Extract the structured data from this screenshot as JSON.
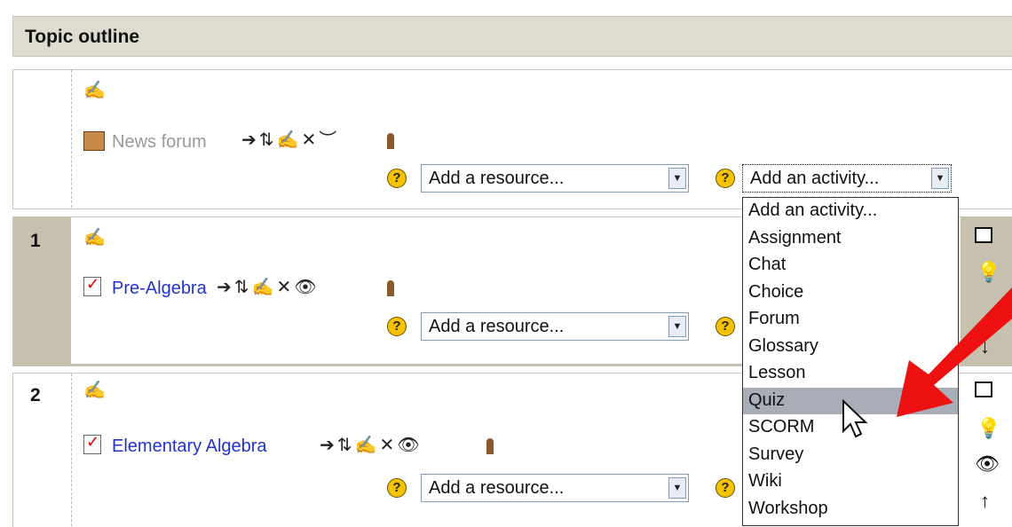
{
  "header": {
    "title": "Topic outline"
  },
  "sections": [
    {
      "number": "",
      "activity": {
        "name": "News forum",
        "hidden": true,
        "eye": "eye-closed-icon"
      },
      "resource_select": {
        "value": "Add a resource..."
      },
      "activity_select": {
        "value": "Add an activity..."
      }
    },
    {
      "number": "1",
      "activity": {
        "name": "Pre-Algebra",
        "hidden": false,
        "eye": "eye-open-icon"
      },
      "resource_select": {
        "value": "Add a resource..."
      }
    },
    {
      "number": "2",
      "activity": {
        "name": "Elementary Algebra",
        "hidden": false,
        "eye": "eye-open-icon"
      },
      "resource_select": {
        "value": "Add a resource..."
      }
    }
  ],
  "dropdown": {
    "options": [
      "Add an activity...",
      "Assignment",
      "Chat",
      "Choice",
      "Forum",
      "Glossary",
      "Lesson",
      "Quiz",
      "SCORM",
      "Survey",
      "Wiki",
      "Workshop"
    ],
    "highlighted": "Quiz"
  },
  "colors": {
    "section_highlight": "#c8c0ae",
    "header_bg": "#dedcd1",
    "link": "#2233cc",
    "arrow": "#ee1111",
    "option_highlight": "#a9adb8"
  }
}
